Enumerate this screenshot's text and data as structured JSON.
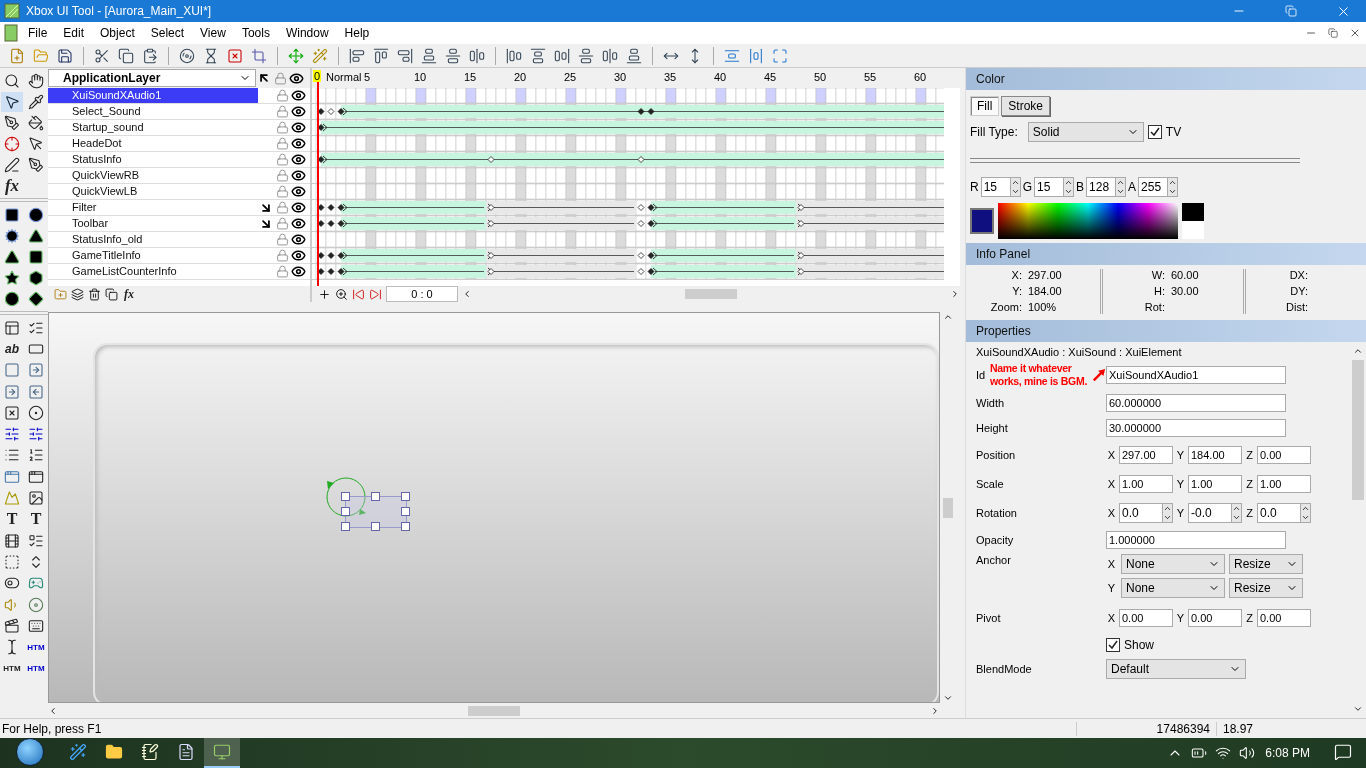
{
  "window": {
    "title": "Xbox UI Tool - [Aurora_Main_XUI*]"
  },
  "menu": [
    "File",
    "Edit",
    "Object",
    "Select",
    "View",
    "Tools",
    "Window",
    "Help"
  ],
  "tool_palette_labels": [
    "fx",
    "ab",
    "T",
    "T",
    "HTM",
    "HTM",
    "HTM"
  ],
  "layers": {
    "dropdown": "ApplicationLayer",
    "fx_label": "fx",
    "rows": [
      {
        "name": "XuiSoundXAudio1",
        "selected": true,
        "linked": false,
        "kind": "empty"
      },
      {
        "name": "Select_Sound",
        "selected": false,
        "linked": false,
        "kind": "sound"
      },
      {
        "name": "Startup_sound",
        "selected": false,
        "linked": false,
        "kind": "single"
      },
      {
        "name": "HeadeDot",
        "selected": false,
        "linked": false,
        "kind": "empty"
      },
      {
        "name": "StatusInfo",
        "selected": false,
        "linked": false,
        "kind": "status"
      },
      {
        "name": "QuickViewRB",
        "selected": false,
        "linked": false,
        "kind": "empty"
      },
      {
        "name": "QuickViewLB",
        "selected": false,
        "linked": false,
        "kind": "empty"
      },
      {
        "name": "Filter",
        "selected": false,
        "linked": true,
        "kind": "animated"
      },
      {
        "name": "Toolbar",
        "selected": false,
        "linked": true,
        "kind": "animated"
      },
      {
        "name": "StatusInfo_old",
        "selected": false,
        "linked": false,
        "kind": "empty"
      },
      {
        "name": "GameTitleInfo",
        "selected": false,
        "linked": false,
        "kind": "animated"
      },
      {
        "name": "GameListCounterInfo",
        "selected": false,
        "linked": false,
        "kind": "animated"
      }
    ]
  },
  "timeline": {
    "current_frame": "0",
    "mode": "Normal",
    "ticks": [
      "5",
      "10",
      "15",
      "20",
      "25",
      "30",
      "35",
      "40",
      "45",
      "50",
      "55",
      "60"
    ],
    "time": "0 : 0"
  },
  "color": {
    "title": "Color",
    "tabs": [
      {
        "label": "Fill",
        "selected": true
      },
      {
        "label": "Stroke",
        "selected": false
      }
    ],
    "fill_type_label": "Fill Type:",
    "fill_type": "Solid",
    "tv": {
      "label": "TV",
      "checked": true
    },
    "channels": [
      {
        "label": "R",
        "value": "15"
      },
      {
        "label": "G",
        "value": "15"
      },
      {
        "label": "B",
        "value": "128"
      },
      {
        "label": "A",
        "value": "255"
      }
    ]
  },
  "info": {
    "title": "Info Panel",
    "columns": [
      [
        {
          "label": "X:",
          "value": "297.00"
        },
        {
          "label": "Y:",
          "value": "184.00"
        },
        {
          "label": "Zoom:",
          "value": "100%"
        }
      ],
      [
        {
          "label": "W:",
          "value": "60.00"
        },
        {
          "label": "H:",
          "value": "30.00"
        },
        {
          "label": "Rot:"
        }
      ],
      [
        {
          "label": "DX:"
        },
        {
          "label": "DY:"
        },
        {
          "label": "Dist:"
        }
      ]
    ]
  },
  "properties": {
    "title": "Properties",
    "class_path": "XuiSoundXAudio : XuiSound : XuiElement",
    "annotation": "Name it whatever works, mine is BGM.",
    "rows": [
      {
        "kind": "noted_field",
        "label": "Id",
        "value": "XuiSoundXAudio1"
      },
      {
        "kind": "field",
        "label": "Width",
        "value": "60.000000"
      },
      {
        "kind": "field",
        "label": "Height",
        "value": "30.000000"
      },
      {
        "kind": "xyz",
        "label": "Position",
        "values": [
          {
            "axis": "X",
            "value": "297.00"
          },
          {
            "axis": "Y",
            "value": "184.00"
          },
          {
            "axis": "Z",
            "value": "0.00"
          }
        ]
      },
      {
        "kind": "xyz",
        "label": "Scale",
        "values": [
          {
            "axis": "X",
            "value": "1.00"
          },
          {
            "axis": "Y",
            "value": "1.00"
          },
          {
            "axis": "Z",
            "value": "1.00"
          }
        ]
      },
      {
        "kind": "spin",
        "label": "Rotation",
        "values": [
          {
            "axis": "X",
            "value": "0.0"
          },
          {
            "axis": "Y",
            "value": "-0.0"
          },
          {
            "axis": "Z",
            "value": "0.0"
          }
        ]
      },
      {
        "kind": "field",
        "label": "Opacity",
        "value": "1.000000"
      },
      {
        "kind": "anchor",
        "label": "Anchor",
        "values": [
          {
            "axis": "X",
            "mode": "None",
            "resize": "Resize"
          },
          {
            "axis": "Y",
            "mode": "None",
            "resize": "Resize"
          }
        ]
      },
      {
        "kind": "xyz",
        "label": "Pivot",
        "values": [
          {
            "axis": "X",
            "value": "0.00"
          },
          {
            "axis": "Y",
            "value": "0.00"
          },
          {
            "axis": "Z",
            "value": "0.00"
          }
        ]
      },
      {
        "kind": "check",
        "label": "Show",
        "checked": true
      },
      {
        "kind": "select",
        "label": "BlendMode",
        "value": "Default"
      }
    ]
  },
  "status_bar": {
    "help": "For Help, press F1",
    "memory": "17486394",
    "fps": "18.97"
  },
  "taskbar": {
    "time": "6:08 PM"
  }
}
